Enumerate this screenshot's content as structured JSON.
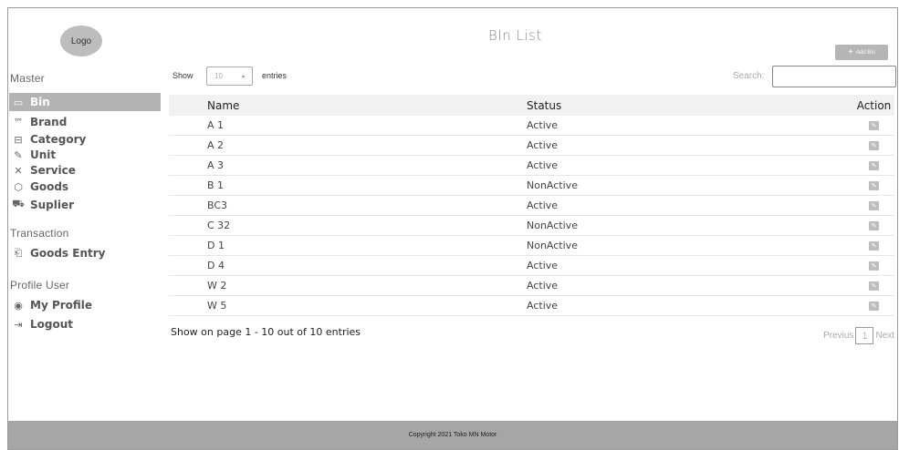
{
  "logo": {
    "label": "Logo"
  },
  "sidebar": {
    "sections": [
      {
        "heading": "Master",
        "items": [
          {
            "label": "Bin",
            "icon": "bin-icon",
            "glyph": "▭"
          },
          {
            "label": "Brand",
            "icon": "trademark-icon",
            "glyph": "™"
          },
          {
            "label": "Category",
            "icon": "folder-icon",
            "glyph": "⊟"
          },
          {
            "label": "Unit",
            "icon": "pencil-icon",
            "glyph": "✎"
          },
          {
            "label": "Service",
            "icon": "tools-icon",
            "glyph": "✕"
          },
          {
            "label": "Goods",
            "icon": "box-icon",
            "glyph": "⬡"
          },
          {
            "label": "Suplier",
            "icon": "truck-icon",
            "glyph": "⛟"
          }
        ]
      },
      {
        "heading": "Transaction",
        "items": [
          {
            "label": "Goods Entry",
            "icon": "clipboard-icon",
            "glyph": "⎗"
          }
        ]
      },
      {
        "heading": "Profile User",
        "items": [
          {
            "label": "My Profile",
            "icon": "user-circle-icon",
            "glyph": "◉"
          },
          {
            "label": "Logout",
            "icon": "logout-icon",
            "glyph": "⇥"
          }
        ]
      }
    ]
  },
  "main": {
    "title": "BIn List",
    "add_button": "Add Bin",
    "show_label": "Show",
    "entries_per_page": "10",
    "entries_label": "entries",
    "search_label": "Search:",
    "search_value": "",
    "columns": [
      "Name",
      "Status",
      "Action"
    ],
    "rows": [
      {
        "name": "A 1",
        "status": "Active"
      },
      {
        "name": "A 2",
        "status": "Active"
      },
      {
        "name": "A 3",
        "status": "Active"
      },
      {
        "name": "B 1",
        "status": "NonActive"
      },
      {
        "name": "BC3",
        "status": "Active"
      },
      {
        "name": "C 32",
        "status": "NonActive"
      },
      {
        "name": "D 1",
        "status": "NonActive"
      },
      {
        "name": "D 4",
        "status": "Active"
      },
      {
        "name": "W 2",
        "status": "Active"
      },
      {
        "name": "W 5",
        "status": "Active"
      }
    ],
    "info": "Show on page 1 - 10 out of 10 entries",
    "pager": {
      "prev": "Previus",
      "page": "1",
      "next": "Next"
    }
  },
  "footer": {
    "copyright": "Copyright 2021 Toko MN Motor"
  },
  "colors": {
    "sidebar_active": "#b3b3b3",
    "footer": "#a6a6a6",
    "button": "#b5b5b5"
  }
}
